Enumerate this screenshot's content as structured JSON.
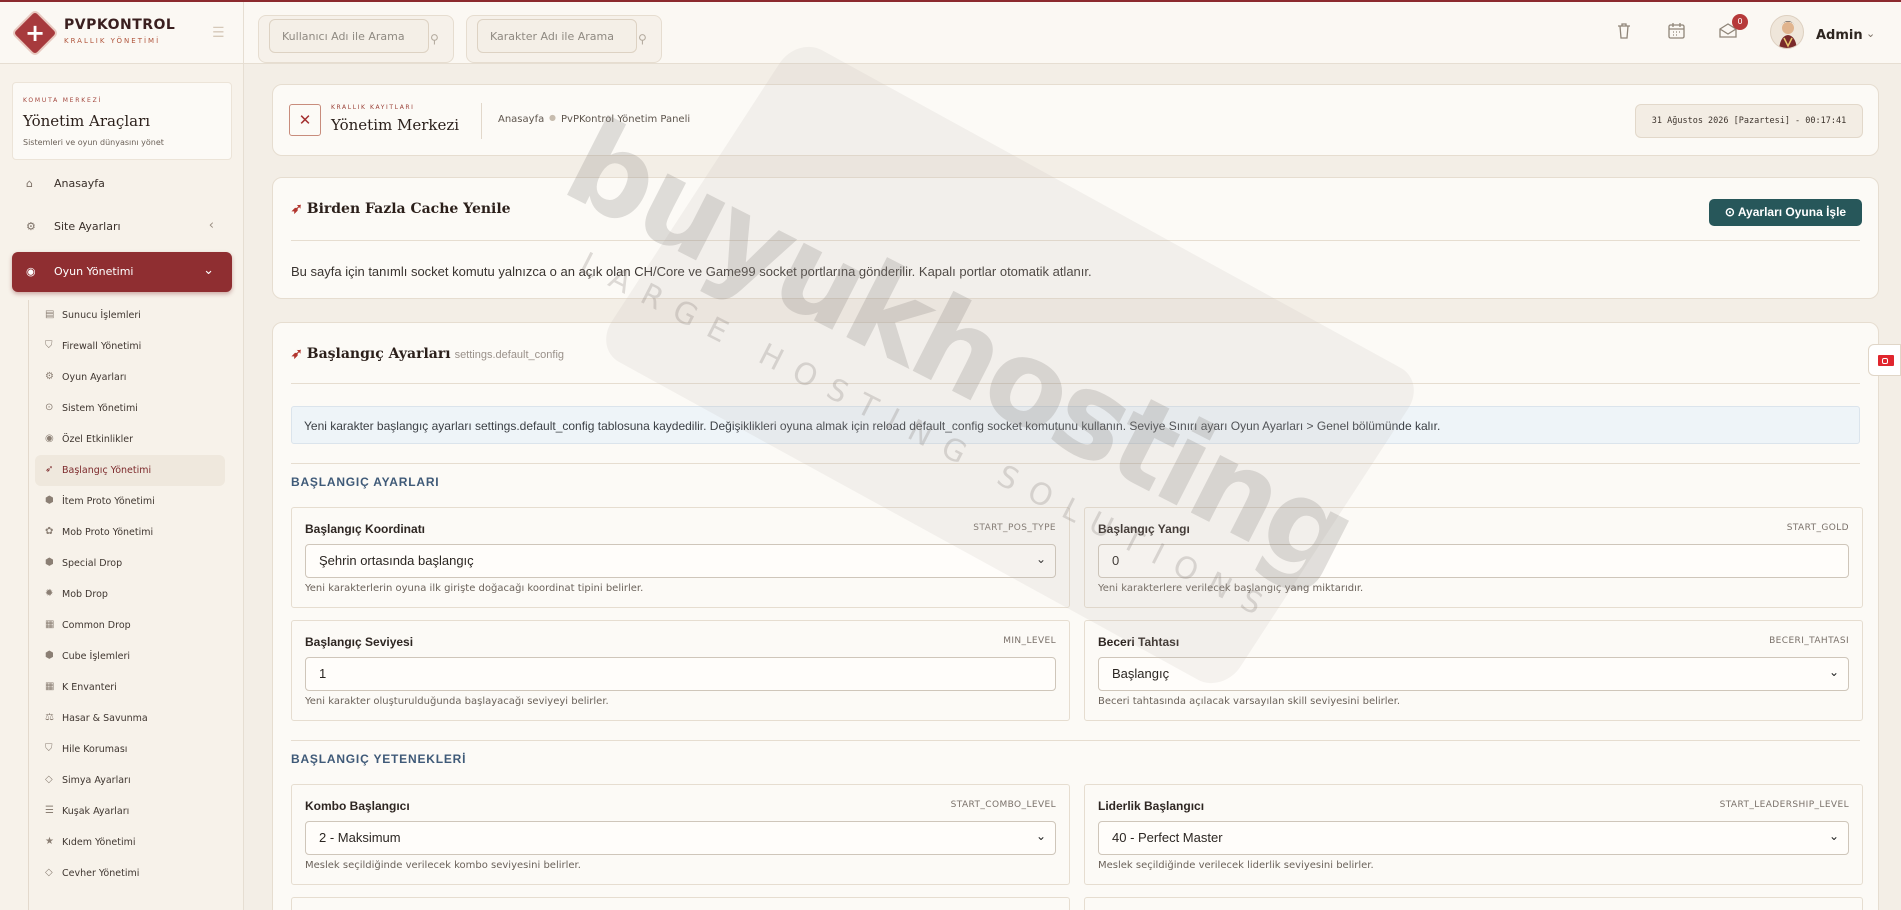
{
  "brand": {
    "name": "PVPKONTROL",
    "subtitle": "KRALLIK YÖNETİMİ"
  },
  "topbar": {
    "search_user_placeholder": "Kullanıcı Adı ile Arama",
    "search_char_placeholder": "Karakter Adı ile Arama",
    "notification_count": "0",
    "admin_name": "Admin"
  },
  "sidebar": {
    "kicker": "KOMUTA MERKEZİ",
    "title": "Yönetim Araçları",
    "description": "Sistemleri ve oyun dünyasını yönet",
    "items": [
      {
        "label": "Anasayfa",
        "icon": "home-icon"
      },
      {
        "label": "Site Ayarları",
        "icon": "gear-icon"
      },
      {
        "label": "Oyun Yönetimi",
        "icon": "gamepad-icon"
      }
    ],
    "subitems": [
      {
        "label": "Sunucu İşlemleri"
      },
      {
        "label": "Firewall Yönetimi"
      },
      {
        "label": "Oyun Ayarları"
      },
      {
        "label": "Sistem Yönetimi"
      },
      {
        "label": "Özel Etkinlikler"
      },
      {
        "label": "Başlangıç Yönetimi"
      },
      {
        "label": "İtem Proto Yönetimi"
      },
      {
        "label": "Mob Proto Yönetimi"
      },
      {
        "label": "Special Drop"
      },
      {
        "label": "Mob Drop"
      },
      {
        "label": "Common Drop"
      },
      {
        "label": "Cube İşlemleri"
      },
      {
        "label": "K Envanteri"
      },
      {
        "label": "Hasar & Savunma"
      },
      {
        "label": "Hile Koruması"
      },
      {
        "label": "Simya Ayarları"
      },
      {
        "label": "Kuşak Ayarları"
      },
      {
        "label": "Kıdem Yönetimi"
      },
      {
        "label": "Cevher Yönetimi"
      }
    ]
  },
  "header": {
    "kicker": "KRALLIK KAYITLARI",
    "title": "Yönetim Merkezi",
    "breadcrumb": [
      "Anasayfa",
      "PvPKontrol Yönetim Paneli"
    ],
    "date": "31 Ağustos 2026 [Pazartesi] - 00:17:41"
  },
  "cache": {
    "title": "Birden Fazla Cache Yenile",
    "button": "Ayarları Oyuna İşle",
    "description": "Bu sayfa için tanımlı socket komutu yalnızca o an açık olan CH/Core ve Game99 socket portlarına gönderilir. Kapalı portlar otomatik atlanır."
  },
  "settings": {
    "title": "Başlangıç Ayarları",
    "code": "settings.default_config",
    "info": "Yeni karakter başlangıç ayarları settings.default_config tablosuna kaydedilir. Değişiklikleri oyuna almak için reload default_config socket komutunu kullanın. Seviye Sınırı ayarı Oyun Ayarları > Genel bölümünde kalır.",
    "group1": "BAŞLANGIÇ AYARLARI",
    "group2": "BAŞLANGIÇ YETENEKLERİ",
    "fields": [
      {
        "label": "Başlangıç Koordinatı",
        "code": "START_POS_TYPE",
        "value": "Şehrin ortasında başlangıç",
        "help": "Yeni karakterlerin oyuna ilk girişte doğacağı koordinat tipini belirler."
      },
      {
        "label": "Başlangıç Yangı",
        "code": "START_GOLD",
        "value": "0",
        "help": "Yeni karakterlere verilecek başlangıç yang miktarıdır."
      },
      {
        "label": "Başlangıç Seviyesi",
        "code": "MIN_LEVEL",
        "value": "1",
        "help": "Yeni karakter oluşturulduğunda başlayacağı seviyeyi belirler."
      },
      {
        "label": "Beceri Tahtası",
        "code": "BECERI_TAHTASI",
        "value": "Başlangıç",
        "help": "Beceri tahtasında açılacak varsayılan skill seviyesini belirler."
      },
      {
        "label": "Kombo Başlangıcı",
        "code": "START_COMBO_LEVEL",
        "value": "2 - Maksimum",
        "help": "Meslek seçildiğinde verilecek kombo seviyesini belirler."
      },
      {
        "label": "Liderlik Başlangıcı",
        "code": "START_LEADERSHIP_LEVEL",
        "value": "40 - Perfect Master",
        "help": "Meslek seçildiğinde verilecek liderlik seviyesini belirler."
      }
    ]
  },
  "watermark": {
    "main": "buyukhosting",
    "sub": "LARGE HOSTING SOLUTIONS"
  }
}
